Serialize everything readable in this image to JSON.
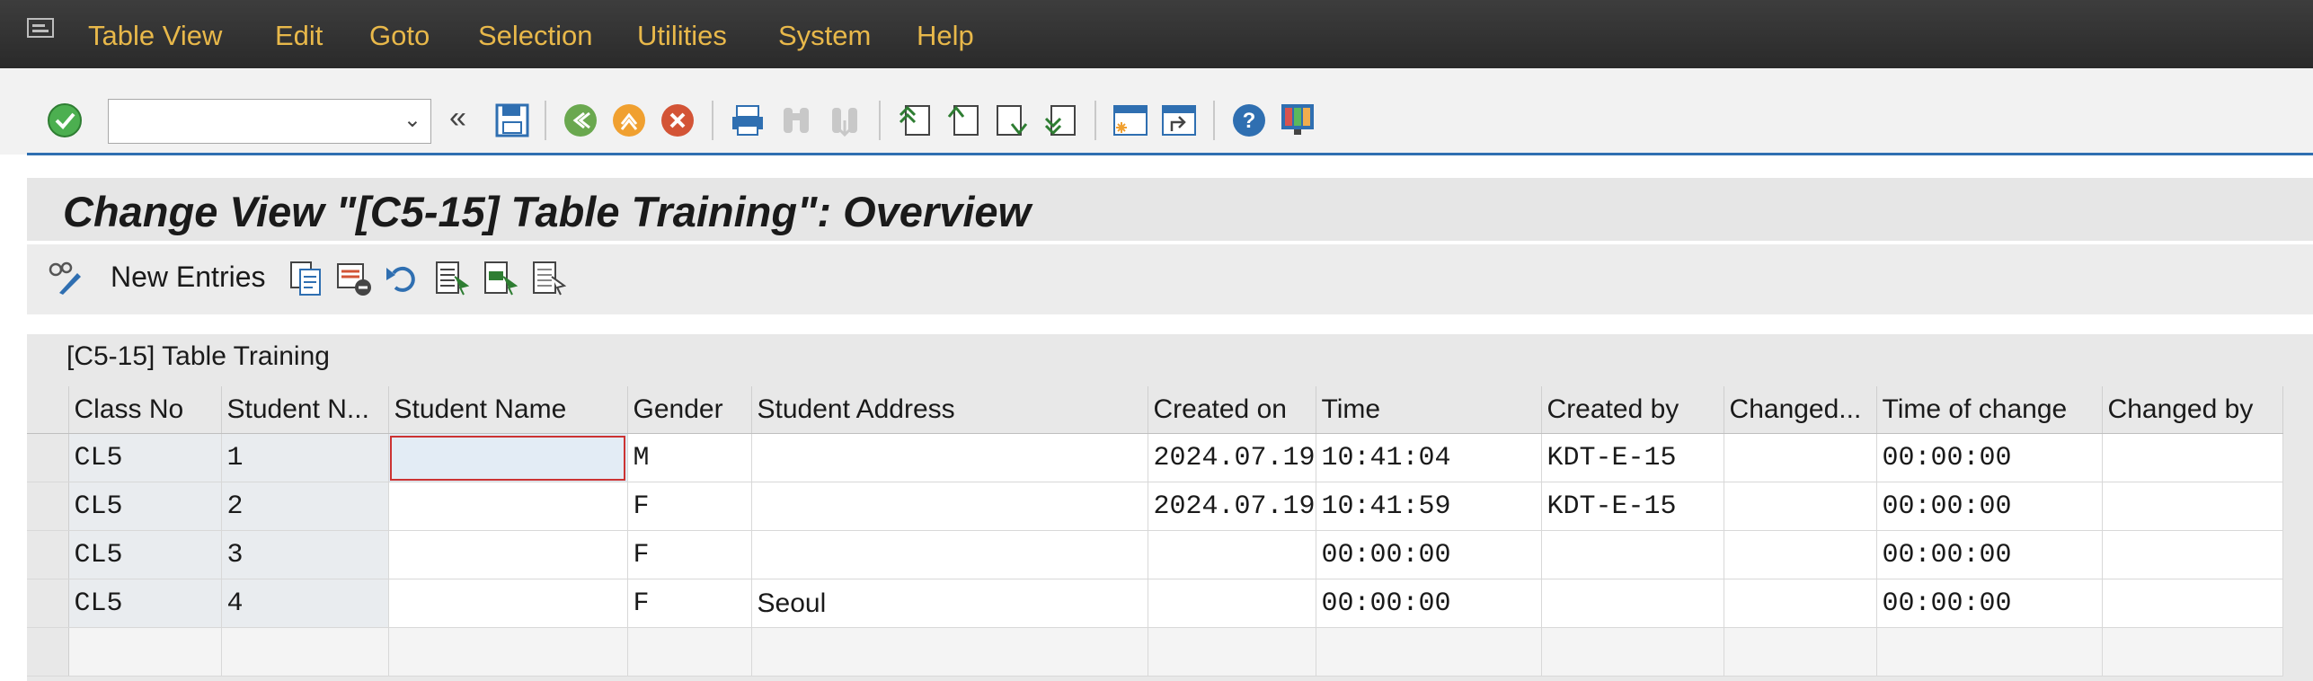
{
  "menu": {
    "items": [
      {
        "label": "Table View"
      },
      {
        "label": "Edit"
      },
      {
        "label": "Goto"
      },
      {
        "label": "Selection"
      },
      {
        "label": "Utilities"
      },
      {
        "label": "System"
      },
      {
        "label": "Help"
      }
    ]
  },
  "toolbar": {
    "command_field_value": "",
    "icons": [
      "enter-icon",
      "back-nav-icon",
      "save-icon",
      "back-icon",
      "exit-icon",
      "cancel-icon",
      "print-icon",
      "find-icon",
      "find-next-icon",
      "first-page-icon",
      "previous-page-icon",
      "next-page-icon",
      "last-page-icon",
      "create-session-icon",
      "shortcut-icon",
      "help-icon",
      "customize-layout-icon"
    ]
  },
  "title": "Change View \"[C5-15] Table Training\": Overview",
  "app_toolbar": {
    "new_entries_label": "New Entries",
    "icons": [
      "display-change-icon",
      "copy-as-icon",
      "delete-icon",
      "undo-change-icon",
      "select-all-icon",
      "select-block-icon",
      "deselect-all-icon"
    ]
  },
  "table": {
    "title": "[C5-15] Table Training",
    "columns": [
      "Class No",
      "Student N...",
      "Student Name",
      "Gender",
      "Student Address",
      "Created on",
      "Time",
      "Created by",
      "Changed...",
      "Time of change",
      "Changed by"
    ],
    "rows": [
      {
        "class_no": "CL5",
        "student_no": "1",
        "student_name": "",
        "gender": "M",
        "address": "",
        "created_on": "2024.07.19",
        "time": "10:41:04",
        "created_by": "KDT-E-15",
        "changed_on": "",
        "time_of_change": "00:00:00",
        "changed_by": ""
      },
      {
        "class_no": "CL5",
        "student_no": "2",
        "student_name": "",
        "gender": "F",
        "address": "",
        "created_on": "2024.07.19",
        "time": "10:41:59",
        "created_by": "KDT-E-15",
        "changed_on": "",
        "time_of_change": "00:00:00",
        "changed_by": ""
      },
      {
        "class_no": "CL5",
        "student_no": "3",
        "student_name": "",
        "gender": "F",
        "address": "",
        "created_on": "",
        "time": "00:00:00",
        "created_by": "",
        "changed_on": "",
        "time_of_change": "00:00:00",
        "changed_by": ""
      },
      {
        "class_no": "CL5",
        "student_no": "4",
        "student_name": "",
        "gender": "F",
        "address": "Seoul",
        "created_on": "",
        "time": "00:00:00",
        "created_by": "",
        "changed_on": "",
        "time_of_change": "00:00:00",
        "changed_by": ""
      }
    ]
  },
  "colors": {
    "menu_text": "#e8b84a",
    "menu_bg": "#2f2f2f",
    "accent_line": "#2f6fb1"
  }
}
